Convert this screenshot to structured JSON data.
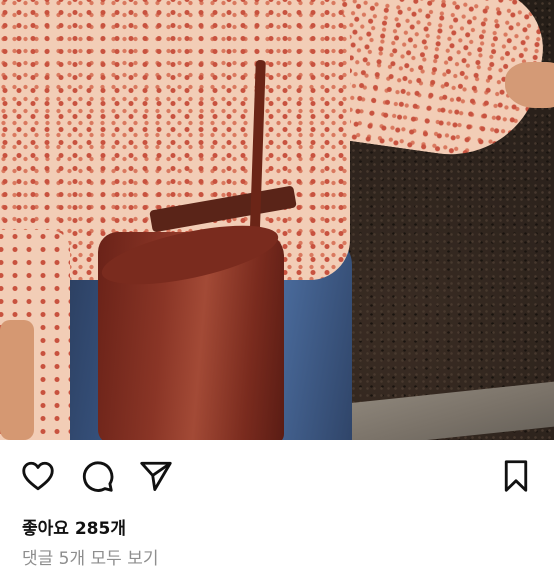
{
  "post": {
    "photo_description_icon": "post-photo",
    "actions": {
      "like_icon": "heart-icon",
      "comment_icon": "comment-bubble-icon",
      "share_icon": "send-paper-plane-icon",
      "save_icon": "bookmark-icon"
    },
    "likes_text": "좋아요 285개",
    "view_comments_text": "댓글 5개 모두 보기"
  },
  "colors": {
    "icon_stroke": "#111111",
    "comments_text": "#8e8e8e",
    "background": "#ffffff"
  }
}
